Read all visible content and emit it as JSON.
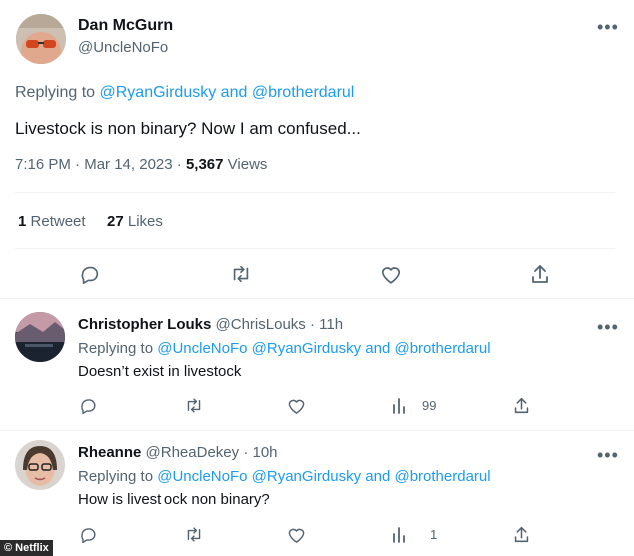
{
  "main_tweet": {
    "author_name": "Dan McGurn",
    "author_handle": "@UncleNoFo",
    "replying_prefix": "Replying to",
    "replying_to_1": "@RyanGirdusky",
    "replying_and": "and",
    "replying_to_2": "@brotherdarul",
    "text": "Livestock is non binary? Now I am confused...",
    "time": "7:16 PM",
    "sep": "·",
    "date": "Mar 14, 2023",
    "views_count": "5,367",
    "views_label": "Views",
    "retweets_count": "1",
    "retweets_label": "Retweet",
    "likes_count": "27",
    "likes_label": "Likes"
  },
  "replies": [
    {
      "author_name": "Christopher Louks",
      "author_handle": "@ChrisLouks",
      "sep": "·",
      "age": "11h",
      "replying_prefix": "Replying to",
      "replying_to_1": "@UncleNoFo",
      "replying_to_2": "@RyanGirdusky",
      "replying_and": "and",
      "replying_to_3": "@brotherdarul",
      "text": "Doesn’t exist in livestock",
      "views": "99"
    },
    {
      "author_name": "Rheanne",
      "author_handle": "@RheaDekey",
      "sep": "·",
      "age": "10h",
      "replying_prefix": "Replying to",
      "replying_to_1": "@UncleNoFo",
      "replying_to_2": "@RyanGirdusky",
      "replying_and": "and",
      "replying_to_3": "@brotherdarul",
      "text": "How is livest ock non binary?",
      "views": "1"
    }
  ],
  "watermark": "© Netflix",
  "colors": {
    "link": "#1d9bf0",
    "muted": "#536471",
    "text": "#0f1419",
    "divider": "#eff3f4"
  }
}
